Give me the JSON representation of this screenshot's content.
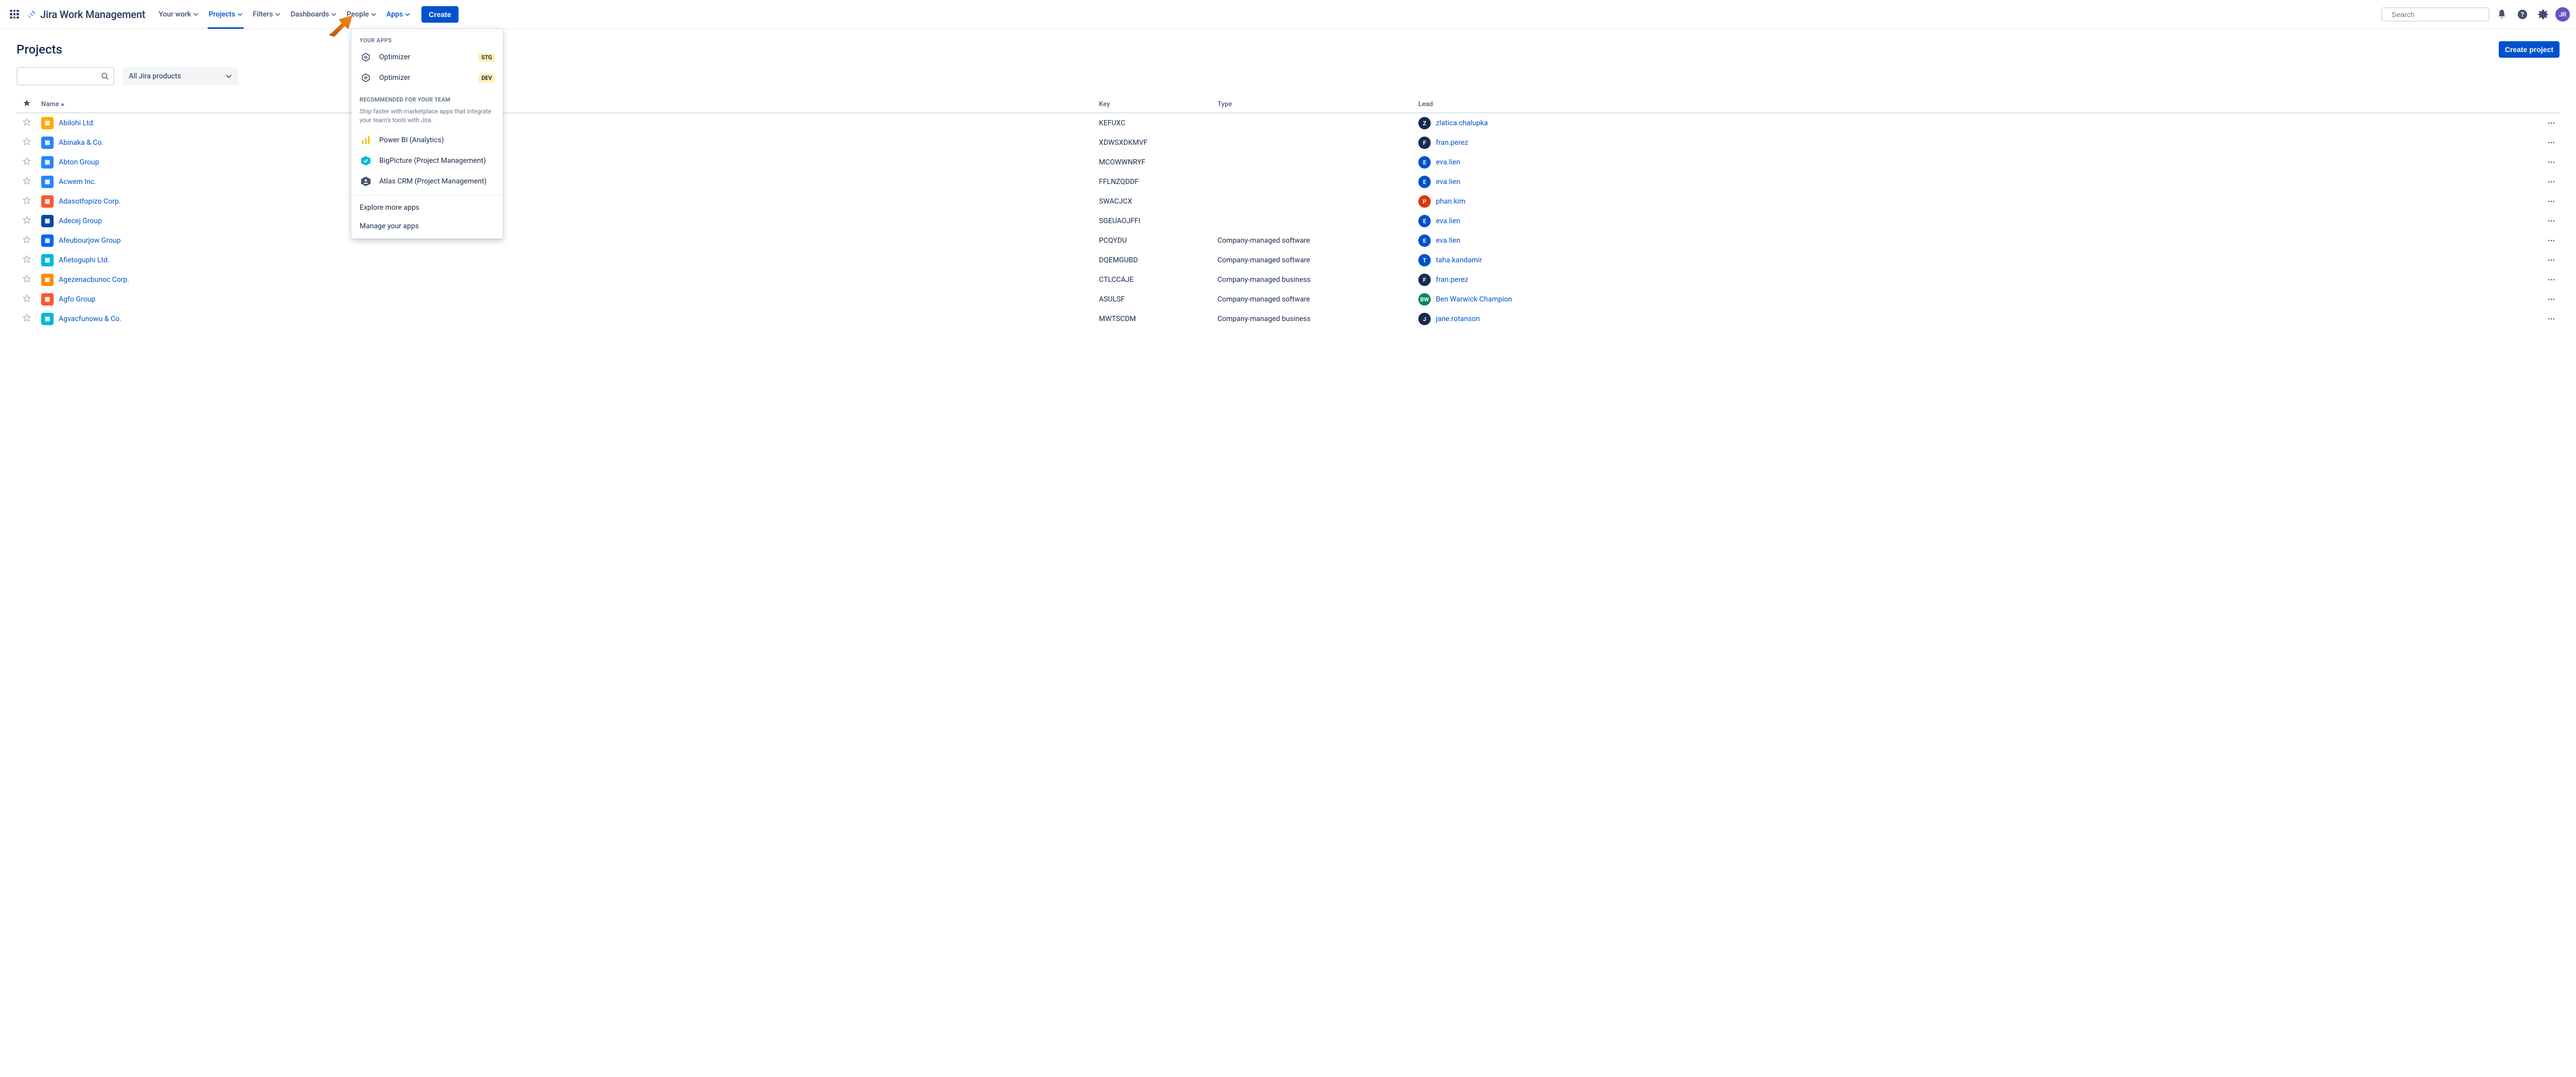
{
  "nav": {
    "product_name": "Jira Work Management",
    "items": [
      {
        "label": "Your work",
        "active": false
      },
      {
        "label": "Projects",
        "active": true
      },
      {
        "label": "Filters",
        "active": false
      },
      {
        "label": "Dashboards",
        "active": false
      },
      {
        "label": "People",
        "active": false
      },
      {
        "label": "Apps",
        "active": false,
        "open": true
      }
    ],
    "create_label": "Create",
    "search_placeholder": "Search",
    "user_initials": "JR"
  },
  "apps_dropdown": {
    "section1_heading": "YOUR APPS",
    "your_apps": [
      {
        "label": "Optimizer",
        "badge": "STG",
        "badge_class": "env-stg"
      },
      {
        "label": "Optimizer",
        "badge": "DEV",
        "badge_class": "env-dev"
      }
    ],
    "section2_heading": "RECOMMENDED FOR YOUR TEAM",
    "section2_subtext": "Ship faster with marketplace apps that integrate your team's tools with Jira.",
    "recommended": [
      {
        "label": "Power BI (Analytics)",
        "icon_bg": "transparent"
      },
      {
        "label": "BigPicture (Project Management)",
        "icon_bg": "#00B8D9"
      },
      {
        "label": "Atlas CRM (Project Management)",
        "icon_bg": "#42526E"
      }
    ],
    "explore_label": "Explore more apps",
    "manage_label": "Manage your apps"
  },
  "page": {
    "title": "Projects",
    "create_project_label": "Create project",
    "product_filter_label": "All Jira products"
  },
  "table": {
    "headers": {
      "star": "",
      "name": "Name",
      "key": "Key",
      "type": "Type",
      "lead": "Lead"
    }
  },
  "projects": [
    {
      "name": "Abilohi Ltd.",
      "key": "KEFUXC",
      "type": "",
      "lead": "zlatica.chalupka",
      "lead_initial": "Z",
      "lead_bg": "#172B4D",
      "icon_bg": "#FFAB00"
    },
    {
      "name": "Abinaka & Co.",
      "key": "XDWSXDKMVF",
      "type": "",
      "lead": "fran.perez",
      "lead_initial": "F",
      "lead_bg": "#172B4D",
      "icon_bg": "#2684FF"
    },
    {
      "name": "Abton Group",
      "key": "MCOWWNRYF",
      "type": "",
      "lead": "eva.lien",
      "lead_initial": "E",
      "lead_bg": "#0052CC",
      "icon_bg": "#2684FF"
    },
    {
      "name": "Acwem Inc.",
      "key": "FFLNZQDDF",
      "type": "",
      "lead": "eva.lien",
      "lead_initial": "E",
      "lead_bg": "#0052CC",
      "icon_bg": "#2684FF"
    },
    {
      "name": "Adasotfopizo Corp.",
      "key": "SWACJCX",
      "type": "",
      "lead": "phan.kim",
      "lead_initial": "P",
      "lead_bg": "#DE350B",
      "icon_bg": "#FF5630"
    },
    {
      "name": "Adecej Group",
      "key": "SGEUAOJFFI",
      "type": "",
      "lead": "eva.lien",
      "lead_initial": "E",
      "lead_bg": "#0052CC",
      "icon_bg": "#0747A6"
    },
    {
      "name": "Afeubourjow Group",
      "key": "PCQYDU",
      "type": "Company-managed software",
      "lead": "eva.lien",
      "lead_initial": "E",
      "lead_bg": "#0052CC",
      "icon_bg": "#0065FF"
    },
    {
      "name": "Afietoguphi Ltd.",
      "key": "DQEMGUBD",
      "type": "Company-managed software",
      "lead": "taha.kandamir",
      "lead_initial": "T",
      "lead_bg": "#0052CC",
      "icon_bg": "#00B8D9"
    },
    {
      "name": "Agezenacbunoc Corp.",
      "key": "CTLCCAJE",
      "type": "Company-managed business",
      "lead": "fran.perez",
      "lead_initial": "F",
      "lead_bg": "#172B4D",
      "icon_bg": "#FF8B00"
    },
    {
      "name": "Agfo Group",
      "key": "ASULSF",
      "type": "Company-managed software",
      "lead": "Ben Warwick-Champion",
      "lead_initial": "BW",
      "lead_bg": "#00875A",
      "icon_bg": "#FF5630"
    },
    {
      "name": "Agvacfunowu & Co.",
      "key": "MWTSCDM",
      "type": "Company-managed business",
      "lead": "jane.rotanson",
      "lead_initial": "J",
      "lead_bg": "#172B4D",
      "icon_bg": "#00B8D9"
    }
  ]
}
